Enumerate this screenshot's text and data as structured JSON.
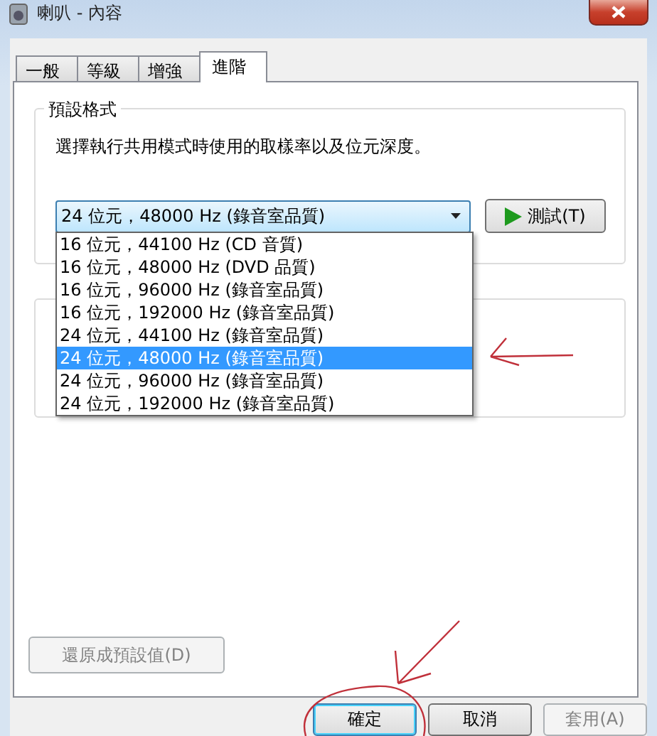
{
  "window": {
    "title": "喇叭 - 內容"
  },
  "tabs": [
    {
      "label": "一般",
      "selected": false
    },
    {
      "label": "等級",
      "selected": false
    },
    {
      "label": "增強",
      "selected": false
    },
    {
      "label": "進階",
      "selected": true
    }
  ],
  "default_format": {
    "title": "預設格式",
    "description": "選擇執行共用模式時使用的取樣率以及位元深度。",
    "combo": {
      "value": "24 位元，48000 Hz (錄音室品質)",
      "expanded": true
    },
    "test_button": "測試(T)",
    "options": [
      {
        "label": "16 位元，44100 Hz (CD 音質)",
        "selected": false
      },
      {
        "label": "16 位元，48000 Hz (DVD 品質)",
        "selected": false
      },
      {
        "label": "16 位元，96000 Hz (錄音室品質)",
        "selected": false
      },
      {
        "label": "16 位元，192000 Hz (錄音室品質)",
        "selected": false
      },
      {
        "label": "24 位元，44100 Hz (錄音室品質)",
        "selected": false
      },
      {
        "label": "24 位元，48000 Hz (錄音室品質)",
        "selected": true
      },
      {
        "label": "24 位元，96000 Hz (錄音室品質)",
        "selected": false
      },
      {
        "label": "24 位元，192000 Hz (錄音室品質)",
        "selected": false
      }
    ]
  },
  "restore_button": {
    "label": "還原成預設值(D)",
    "disabled": true
  },
  "buttons": [
    {
      "label": "確定",
      "disabled": false
    },
    {
      "label": "取消",
      "disabled": false
    },
    {
      "label": "套用(A)",
      "disabled": true
    }
  ]
}
